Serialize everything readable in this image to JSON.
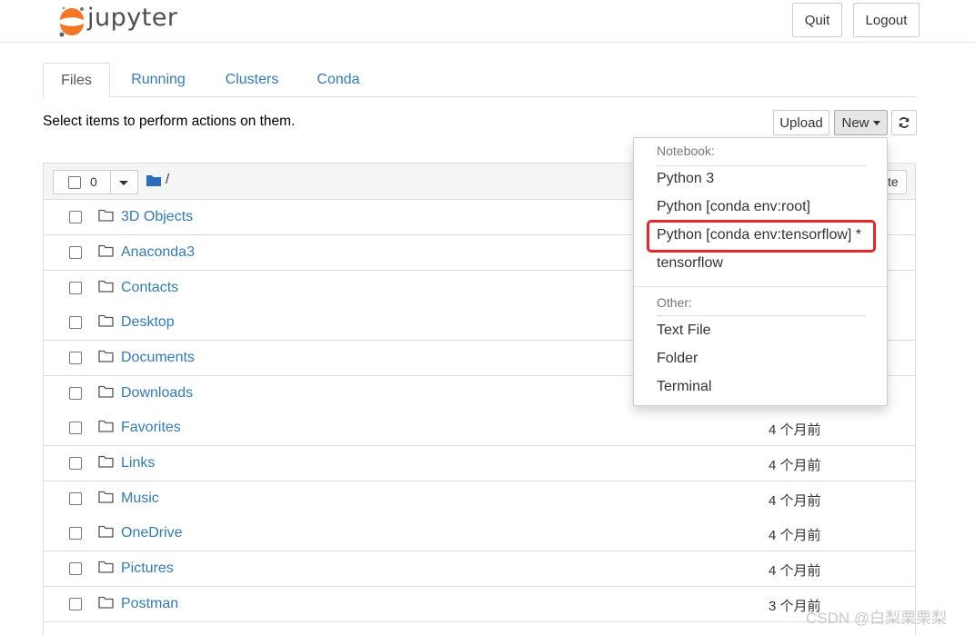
{
  "header": {
    "logo_text": "jupyter",
    "quit_label": "Quit",
    "logout_label": "Logout"
  },
  "tabs": [
    {
      "label": "Files",
      "active": true
    },
    {
      "label": "Running",
      "active": false
    },
    {
      "label": "Clusters",
      "active": false
    },
    {
      "label": "Conda",
      "active": false
    }
  ],
  "toolbar": {
    "info_text": "Select items to perform actions on them.",
    "upload_label": "Upload",
    "new_label": "New",
    "refresh_icon": "refresh-icon"
  },
  "list_header": {
    "selected_count": "0",
    "breadcrumb": "/",
    "hidden_button_label": "te"
  },
  "files": [
    {
      "name": "3D Objects",
      "modified": ""
    },
    {
      "name": "Anaconda3",
      "modified": ""
    },
    {
      "name": "Contacts",
      "modified": ""
    },
    {
      "name": "Desktop",
      "modified": ""
    },
    {
      "name": "Documents",
      "modified": ""
    },
    {
      "name": "Downloads",
      "modified": ""
    },
    {
      "name": "Favorites",
      "modified": "4 个月前"
    },
    {
      "name": "Links",
      "modified": "4 个月前"
    },
    {
      "name": "Music",
      "modified": "4 个月前"
    },
    {
      "name": "OneDrive",
      "modified": "4 个月前"
    },
    {
      "name": "Pictures",
      "modified": "4 个月前"
    },
    {
      "name": "Postman",
      "modified": "3 个月前"
    }
  ],
  "new_menu": {
    "notebook_header": "Notebook:",
    "notebook_items": [
      "Python 3",
      "Python [conda env:root]",
      "Python [conda env:tensorflow] *",
      "tensorflow"
    ],
    "other_header": "Other:",
    "other_items": [
      "Text File",
      "Folder",
      "Terminal"
    ],
    "highlight_color": "#e8262a"
  },
  "watermark": "CSDN @白梨栗栗梨",
  "colors": {
    "link": "#337ab7",
    "logo_orange": "#f37726",
    "folder_blue": "#2a6ebb"
  }
}
